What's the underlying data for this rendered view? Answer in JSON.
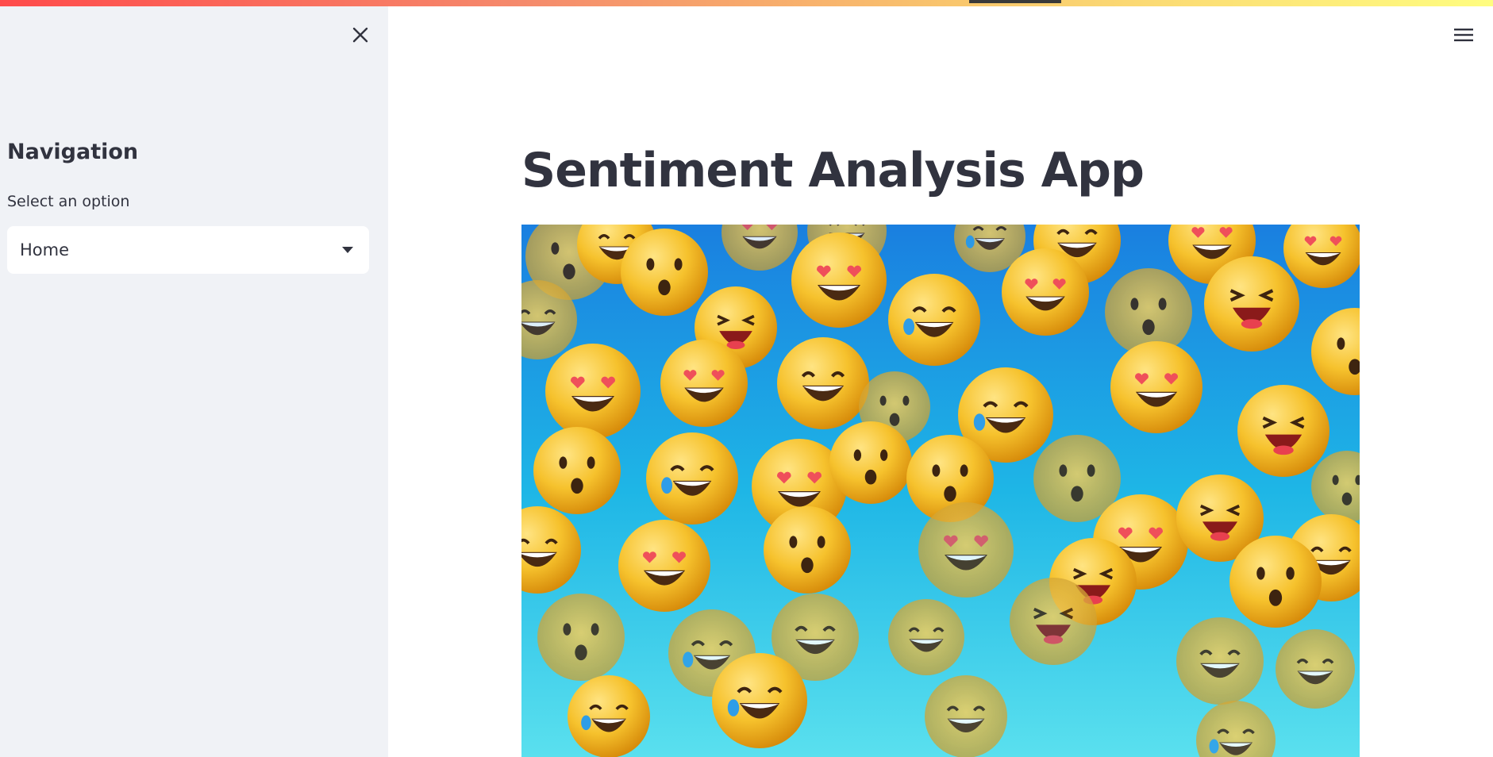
{
  "sidebar": {
    "heading": "Navigation",
    "select_label": "Select an option",
    "selected_option": "Home",
    "close_icon": "close-icon",
    "dropdown_icon": "caret-down-icon"
  },
  "main": {
    "title": "Sentiment Analysis App",
    "menu_icon": "hamburger-menu-icon",
    "hero_image": "emoji-collage-image"
  },
  "colors": {
    "sidebar_bg": "#f0f2f6",
    "text": "#31333f",
    "accent_red": "#ff4b4b",
    "accent_yellow": "#fffd80",
    "emoji_yellow": "#f5c02c",
    "sky_blue": "#1a8fe0",
    "sky_cyan": "#4fd6ec"
  }
}
